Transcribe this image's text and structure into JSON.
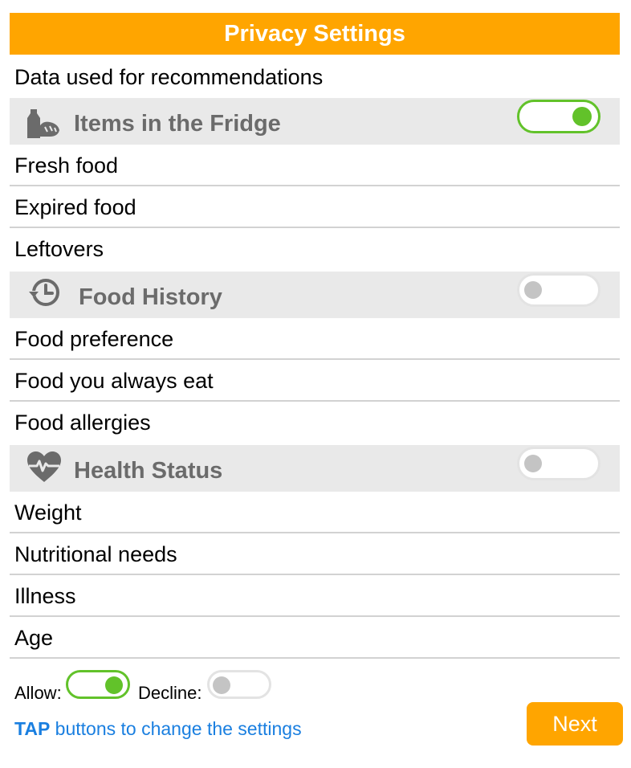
{
  "header": {
    "title": "Privacy Settings"
  },
  "intro": {
    "text": "Data used for recommendations"
  },
  "sections": [
    {
      "icon": "fridge-food-icon",
      "label": "Items in the Fridge",
      "toggle_on": true,
      "items": [
        "Fresh food",
        "Expired food",
        "Leftovers"
      ]
    },
    {
      "icon": "history-clock-icon",
      "label": "Food History",
      "toggle_on": false,
      "items": [
        "Food preference",
        "Food you always eat",
        "Food allergies"
      ]
    },
    {
      "icon": "heart-pulse-icon",
      "label": "Health Status",
      "toggle_on": false,
      "items": [
        "Weight",
        "Nutritional needs",
        "Illness",
        "Age"
      ]
    }
  ],
  "legend": {
    "allow_label": "Allow:",
    "decline_label": "Decline:"
  },
  "hint": {
    "emphasis": "TAP",
    "text": " buttons to change the settings"
  },
  "next_button": {
    "label": "Next"
  },
  "colors": {
    "accent": "#FFA500",
    "toggle_on": "#62C22A",
    "toggle_off": "#C4C4C4",
    "hint": "#1A7FE0",
    "section_bg": "#E9E9E9",
    "section_text": "#6B6B6B"
  }
}
